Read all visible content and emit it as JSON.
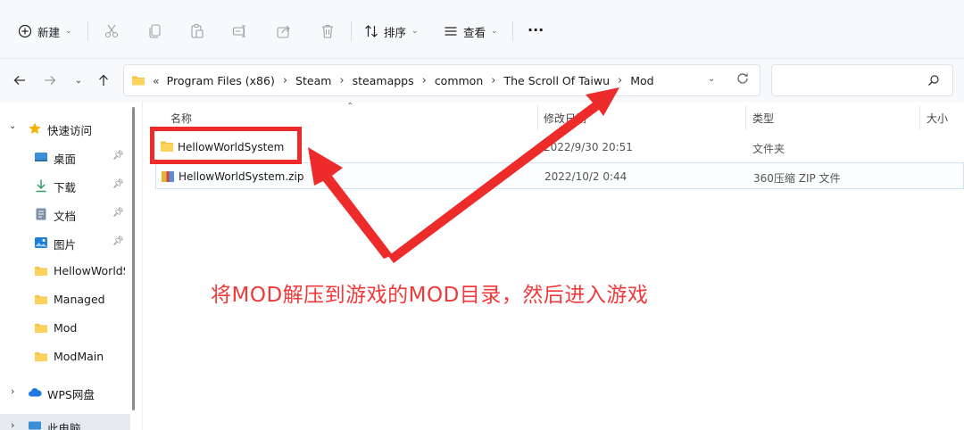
{
  "toolbar": {
    "new_label": "新建",
    "sort_label": "排序",
    "view_label": "查看",
    "more_label": "···"
  },
  "address": {
    "overflow": "«",
    "crumbs": [
      "Program Files (x86)",
      "Steam",
      "steamapps",
      "common",
      "The Scroll Of Taiwu",
      "Mod"
    ],
    "search_placeholder": ""
  },
  "sidebar": {
    "quick_access": "快速访问",
    "items": [
      {
        "label": "桌面",
        "icon": "desktop-icon",
        "pinned": true
      },
      {
        "label": "下载",
        "icon": "download-icon",
        "pinned": true
      },
      {
        "label": "文档",
        "icon": "document-icon",
        "pinned": true
      },
      {
        "label": "图片",
        "icon": "picture-icon",
        "pinned": true
      },
      {
        "label": "HellowWorldSystem",
        "icon": "folder-icon",
        "pinned": false
      },
      {
        "label": "Managed",
        "icon": "folder-icon",
        "pinned": false
      },
      {
        "label": "Mod",
        "icon": "folder-icon",
        "pinned": false
      },
      {
        "label": "ModMain",
        "icon": "folder-icon",
        "pinned": false
      }
    ],
    "wps": "WPS网盘",
    "this_pc": "此电脑"
  },
  "columns": {
    "name": "名称",
    "modified": "修改日期",
    "type": "类型",
    "size": "大小"
  },
  "files": [
    {
      "name": "HellowWorldSystem",
      "modified": "2022/9/30 20:51",
      "type": "文件夹",
      "icon": "folder-icon"
    },
    {
      "name": "HellowWorldSystem.zip",
      "modified": "2022/10/2 0:44",
      "type": "360压缩 ZIP 文件",
      "icon": "zip-archive-icon"
    }
  ],
  "annotation": {
    "caption": "将MOD解压到游戏的MOD目录，然后进入游戏",
    "color": "#ee2b2b"
  }
}
